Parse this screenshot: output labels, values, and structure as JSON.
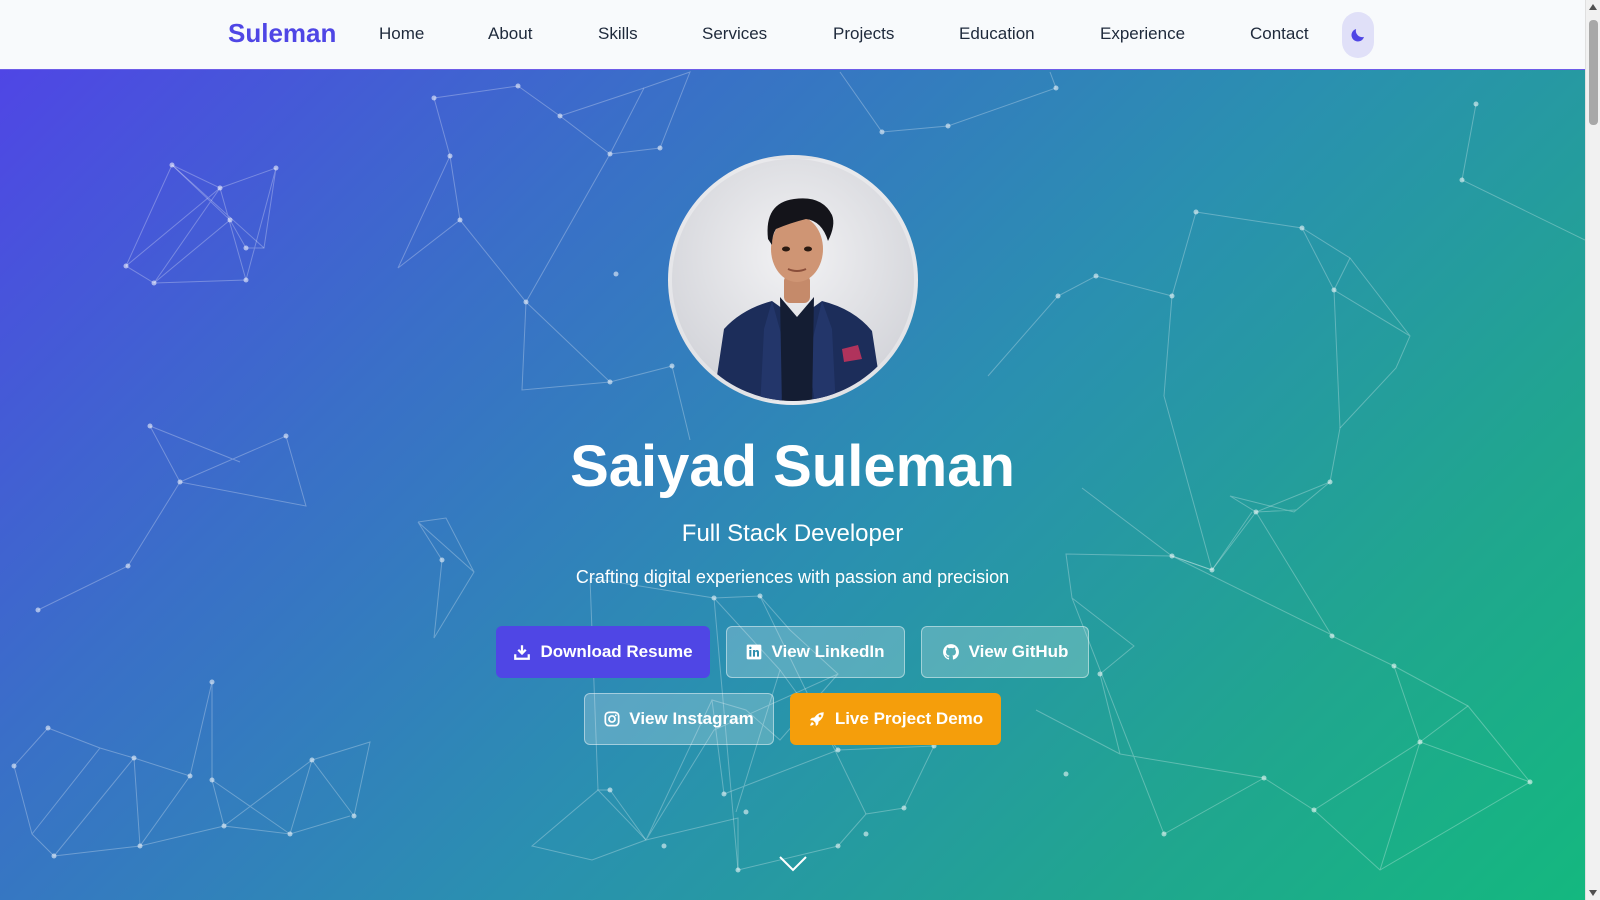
{
  "navbar": {
    "brand": "Suleman",
    "links": [
      {
        "label": "Home"
      },
      {
        "label": "About"
      },
      {
        "label": "Skills"
      },
      {
        "label": "Services"
      },
      {
        "label": "Projects"
      },
      {
        "label": "Education"
      },
      {
        "label": "Experience"
      },
      {
        "label": "Contact"
      }
    ],
    "theme_toggle_icon": "moon-icon"
  },
  "hero": {
    "name": "Saiyad Suleman",
    "role": "Full Stack Developer",
    "tagline": "Crafting digital experiences with passion and precision",
    "buttons": {
      "download_resume": {
        "label": "Download Resume",
        "icon": "download-icon"
      },
      "linkedin": {
        "label": "View LinkedIn",
        "icon": "linkedin-icon"
      },
      "github": {
        "label": "View GitHub",
        "icon": "github-icon"
      },
      "instagram": {
        "label": "View Instagram",
        "icon": "instagram-icon"
      },
      "live_demo": {
        "label": "Live Project Demo",
        "icon": "rocket-icon"
      }
    },
    "scroll_indicator_icon": "chevron-down-icon"
  },
  "colors": {
    "brand": "#4f46e5",
    "gradient_start": "#4f46e5",
    "gradient_end": "#14b87f",
    "orange_button": "#f59e0b"
  }
}
